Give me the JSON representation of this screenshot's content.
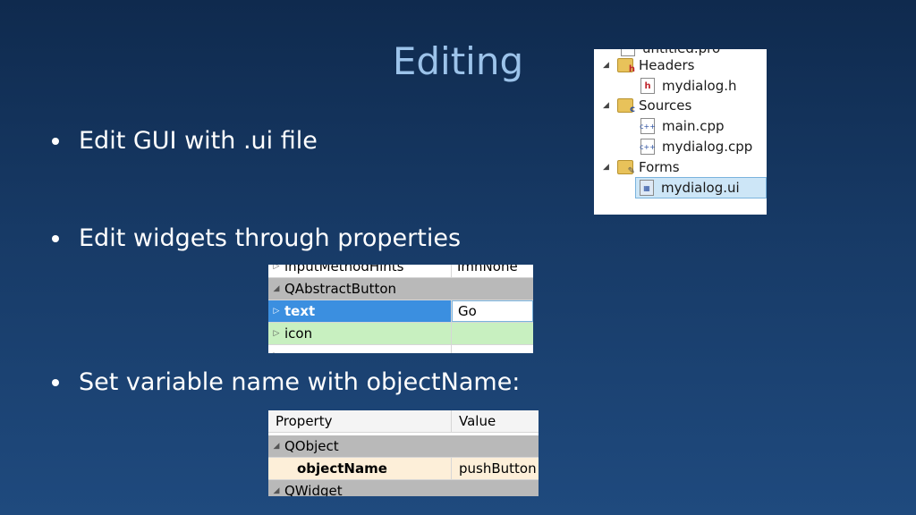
{
  "slide": {
    "title": "Editing",
    "bullets": [
      "Edit GUI with .ui file",
      "Edit widgets through properties",
      "Set variable name with objectName:"
    ]
  },
  "tree": {
    "top_partial": "untitled.pro",
    "headers": "Headers",
    "header_file": "mydialog.h",
    "sources": "Sources",
    "source_files": [
      "main.cpp",
      "mydialog.cpp"
    ],
    "forms": "Forms",
    "form_file": "mydialog.ui"
  },
  "props1": {
    "top_partial_name": "inputMethodHints",
    "top_partial_value": "ImhNone",
    "group": "QAbstractButton",
    "text_name": "text",
    "text_value": "Go",
    "icon_name": "icon"
  },
  "props2": {
    "col_property": "Property",
    "col_value": "Value",
    "group1": "QObject",
    "object_name": "objectName",
    "object_value": "pushButton",
    "group2": "QWidget"
  },
  "colors": {
    "background_top": "#0f2a4e",
    "background_bottom": "#1f4a7e",
    "title": "#9cc3ea",
    "selection_blue": "#3b8fe0",
    "green_row": "#c8f0c0",
    "cream_row": "#fdefd9"
  }
}
